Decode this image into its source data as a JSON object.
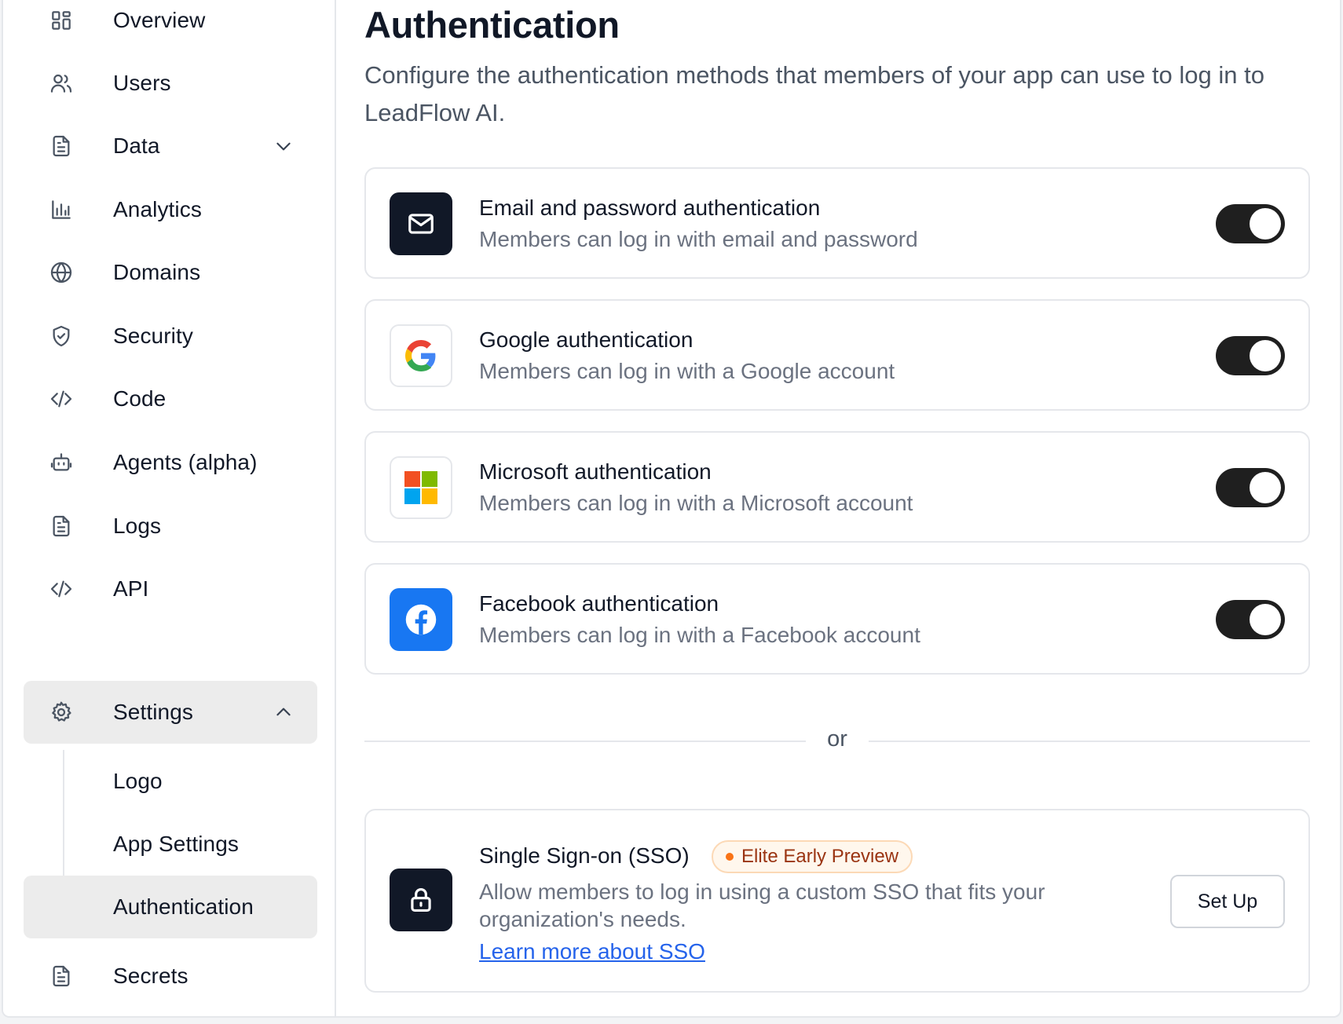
{
  "sidebar": {
    "items": [
      {
        "label": "Overview",
        "icon": "grid-icon"
      },
      {
        "label": "Users",
        "icon": "users-icon"
      },
      {
        "label": "Data",
        "icon": "document-icon"
      },
      {
        "label": "Analytics",
        "icon": "bar-chart-icon"
      },
      {
        "label": "Domains",
        "icon": "globe-icon"
      },
      {
        "label": "Security",
        "icon": "shield-icon"
      },
      {
        "label": "Code",
        "icon": "code-icon"
      },
      {
        "label": "Agents (alpha)",
        "icon": "robot-icon"
      },
      {
        "label": "Logs",
        "icon": "document-icon"
      },
      {
        "label": "API",
        "icon": "code-icon"
      },
      {
        "label": "Settings",
        "icon": "gear-icon"
      },
      {
        "label": "Secrets",
        "icon": "document-icon"
      }
    ],
    "settings_sub": [
      {
        "label": "Logo"
      },
      {
        "label": "App Settings"
      },
      {
        "label": "Authentication"
      }
    ]
  },
  "main": {
    "title": "Authentication",
    "description": "Configure the authentication methods that members of your app can use to log in to LeadFlow AI.",
    "methods": [
      {
        "title": "Email and password authentication",
        "subtitle": "Members can log in with email and password",
        "enabled": true,
        "icon": "mail-icon"
      },
      {
        "title": "Google authentication",
        "subtitle": "Members can log in with a Google account",
        "enabled": true,
        "icon": "google-icon"
      },
      {
        "title": "Microsoft authentication",
        "subtitle": "Members can log in with a Microsoft account",
        "enabled": true,
        "icon": "microsoft-icon"
      },
      {
        "title": "Facebook authentication",
        "subtitle": "Members can log in with a Facebook account",
        "enabled": true,
        "icon": "facebook-icon"
      }
    ],
    "divider_text": "or",
    "sso": {
      "title": "Single Sign-on (SSO)",
      "badge": "Elite Early Preview",
      "description": "Allow members to log in using a custom SSO that fits your organization's needs.",
      "link": "Learn more about SSO",
      "button": "Set Up",
      "icon": "lock-icon"
    }
  },
  "colors": {
    "toggle_on": "#1f1f1f",
    "active_nav_bg": "#ececec",
    "link": "#2563eb",
    "badge_text": "#9a3412",
    "badge_dot": "#f97316",
    "facebook_blue": "#1877f2"
  }
}
